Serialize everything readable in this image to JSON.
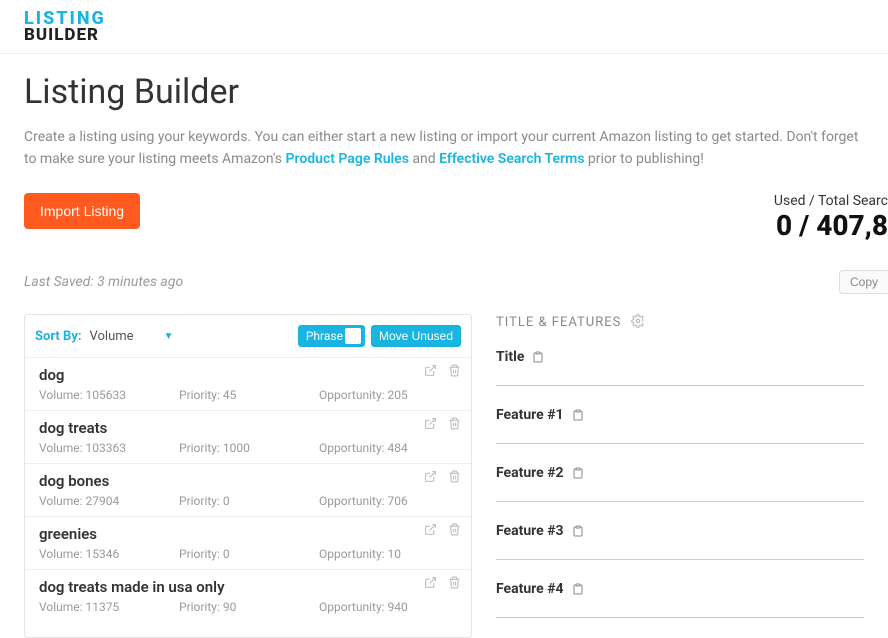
{
  "logo": {
    "line1": "LISTING",
    "line2": "BUILDER"
  },
  "page": {
    "title": "Listing Builder",
    "intro_prefix": "Create a listing using your keywords. You can either start a new listing or import your current Amazon listing to get started. Don't forget to make sure your listing meets Amazon's ",
    "link1": "Product Page Rules",
    "middle": " and ",
    "link2": "Effective Search Terms",
    "intro_suffix": " prior to publishing!"
  },
  "actions": {
    "import": "Import Listing",
    "totals_label": "Used / Total Searc",
    "totals_value": "0 / 407,8",
    "saved": "Last Saved: 3 minutes ago",
    "copy": "Copy"
  },
  "sort": {
    "label": "Sort By:",
    "value": "Volume",
    "phrase": "Phrase",
    "move_unused": "Move Unused"
  },
  "stat_labels": {
    "volume": "Volume: ",
    "priority": "Priority: ",
    "opportunity": "Opportunity: "
  },
  "keywords": [
    {
      "term": "dog",
      "volume": "105633",
      "priority": "45",
      "opportunity": "205"
    },
    {
      "term": "dog treats",
      "volume": "103363",
      "priority": "1000",
      "opportunity": "484"
    },
    {
      "term": "dog bones",
      "volume": "27904",
      "priority": "0",
      "opportunity": "706"
    },
    {
      "term": "greenies",
      "volume": "15346",
      "priority": "0",
      "opportunity": "10"
    },
    {
      "term": "dog treats made in usa only",
      "volume": "11375",
      "priority": "90",
      "opportunity": "940"
    }
  ],
  "right": {
    "section": "TITLE & FEATURES",
    "fields": [
      {
        "label": "Title"
      },
      {
        "label": "Feature #1"
      },
      {
        "label": "Feature #2"
      },
      {
        "label": "Feature #3"
      },
      {
        "label": "Feature #4"
      }
    ]
  }
}
